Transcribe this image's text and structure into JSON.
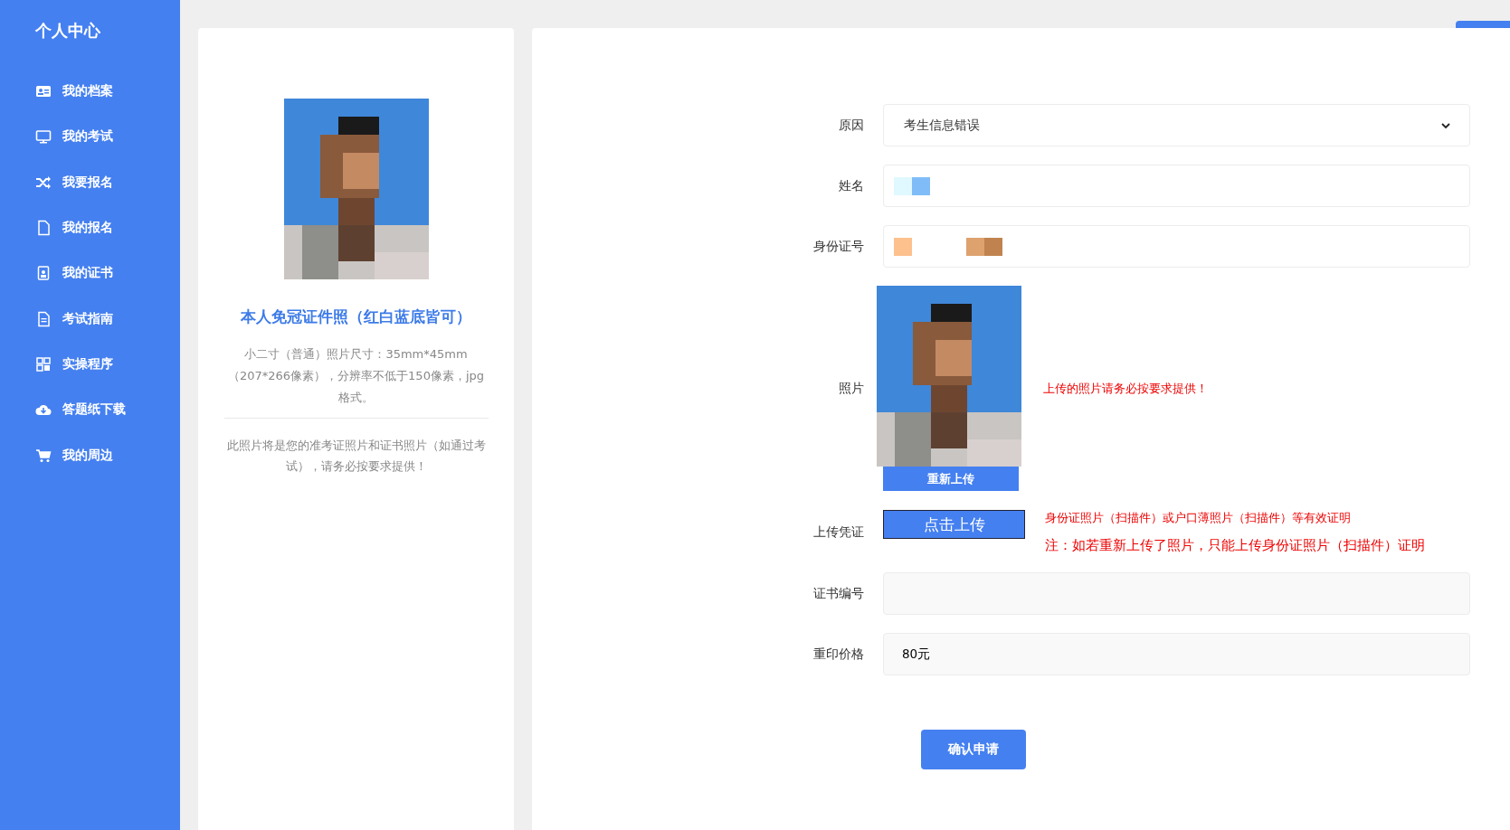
{
  "sidebar": {
    "title": "个人中心",
    "items": [
      {
        "label": "我的档案"
      },
      {
        "label": "我的考试"
      },
      {
        "label": "我要报名"
      },
      {
        "label": "我的报名"
      },
      {
        "label": "我的证书"
      },
      {
        "label": "考试指南"
      },
      {
        "label": "实操程序"
      },
      {
        "label": "答题纸下载"
      },
      {
        "label": "我的周边"
      }
    ]
  },
  "photo_card": {
    "title": "本人免冠证件照（红白蓝底皆可）",
    "requirements": "小二寸（普通）照片尺寸：35mm*45mm（207*266像素），分辨率不低于150像素，jpg格式。",
    "note": "此照片将是您的准考证照片和证书照片（如通过考试），请务必按要求提供！"
  },
  "form": {
    "reason": {
      "label": "原因",
      "value": "考生信息错误"
    },
    "name": {
      "label": "姓名"
    },
    "id_number": {
      "label": "身份证号"
    },
    "photo": {
      "label": "照片",
      "reupload_button": "重新上传",
      "hint": "上传的照片请务必按要求提供！"
    },
    "proof": {
      "label": "上传凭证",
      "button": "点击上传",
      "hint": "身份证照片（扫描件）或户口薄照片（扫描件）等有效证明",
      "note": "注：如若重新上传了照片，只能上传身份证照片（扫描件）证明"
    },
    "certificate_number": {
      "label": "证书编号"
    },
    "reprint_price": {
      "label": "重印价格",
      "value": "80元"
    },
    "submit_button": "确认申请"
  }
}
